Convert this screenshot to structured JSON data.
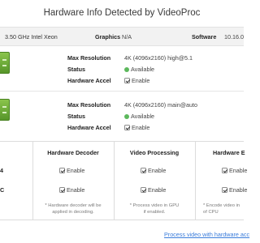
{
  "title": "Hardware Info Detected by VideoProc",
  "system": {
    "cpu": "3.50 GHz Intel Xeon",
    "graphics_label": "Graphics",
    "graphics_value": "N/A",
    "software_label": "Software",
    "software_value": "10.16.0"
  },
  "gpus": [
    {
      "icon": "gpu-icon",
      "max_resolution_label": "Max Resolution",
      "max_resolution_value": "4K (4096x2160) high@5.1",
      "status_label": "Status",
      "status_value": "Available",
      "hw_accel_label": "Hardware Accel",
      "hw_accel_value": "Enable"
    },
    {
      "icon": "gpu-icon",
      "max_resolution_label": "Max Resolution",
      "max_resolution_value": "4K (4096x2160) main@auto",
      "status_label": "Status",
      "status_value": "Available",
      "hw_accel_label": "Hardware Accel",
      "hw_accel_value": "Enable"
    }
  ],
  "features": {
    "columns": [
      "Hardware Decoder",
      "Video Processing",
      "Hardware E"
    ],
    "row_labels": [
      "4",
      "C"
    ],
    "cell_value": "Enable",
    "notes": [
      "* Hardware decoder will be\napplied in decoding.",
      "* Process video in GPU\nif enabled.",
      "* Encode video in\nof CPU"
    ]
  },
  "footer_link": "Process video with hardware acc",
  "colors": {
    "accent_link": "#3b7ddb",
    "status_available": "#5cb85c",
    "gpu_icon_green": "#6fae35"
  }
}
